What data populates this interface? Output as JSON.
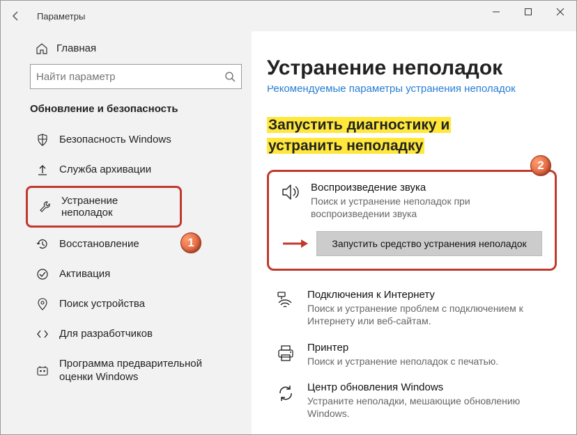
{
  "window": {
    "title": "Параметры"
  },
  "sidebar": {
    "home": "Главная",
    "search_placeholder": "Найти параметр",
    "section": "Обновление и безопасность",
    "items": [
      {
        "label": "Безопасность Windows"
      },
      {
        "label": "Служба архивации"
      },
      {
        "label": "Устранение неполадок"
      },
      {
        "label": "Восстановление"
      },
      {
        "label": "Активация"
      },
      {
        "label": "Поиск устройства"
      },
      {
        "label": "Для разработчиков"
      },
      {
        "label": "Программа предварительной оценки Windows"
      }
    ]
  },
  "main": {
    "heading": "Устранение неполадок",
    "blue_truncated": "Рекомендуемые параметры устранения неполадок",
    "yellow_heading": "Запустить диагностику и устранить неполадку",
    "audio": {
      "title": "Воспроизведение звука",
      "desc": "Поиск и устранение неполадок при воспроизведении звука",
      "button": "Запустить средство устранения неполадок"
    },
    "items": [
      {
        "title": "Подключения к Интернету",
        "desc": "Поиск и устранение проблем с подключением к Интернету или веб-сайтам."
      },
      {
        "title": "Принтер",
        "desc": "Поиск и устранение неполадок с печатью."
      },
      {
        "title": "Центр обновления Windows",
        "desc": "Устраните неполадки, мешающие обновлению Windows."
      }
    ]
  },
  "markers": {
    "one": "1",
    "two": "2"
  }
}
